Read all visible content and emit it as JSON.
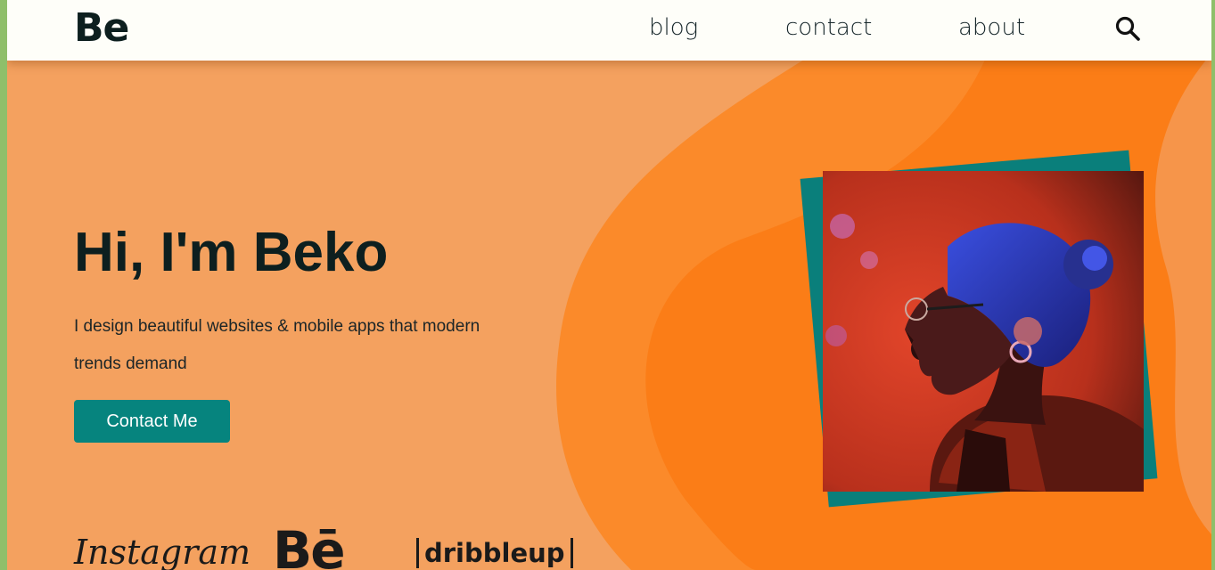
{
  "header": {
    "logo": "Be",
    "nav": [
      "blog",
      "contact",
      "about"
    ],
    "search_icon": "search-icon"
  },
  "hero": {
    "title": "Hi, I'm Beko",
    "subtitle": "I design beautiful websites & mobile apps that modern trends demand",
    "cta_label": "Contact Me"
  },
  "brands": [
    "Instagram",
    "Bē",
    "dribbleup"
  ],
  "colors": {
    "background": "#f4a15f",
    "accent_orange": "#fb7d17",
    "teal": "#06847e",
    "navbar": "#fefef9",
    "text_dark": "#0d1f1f"
  }
}
